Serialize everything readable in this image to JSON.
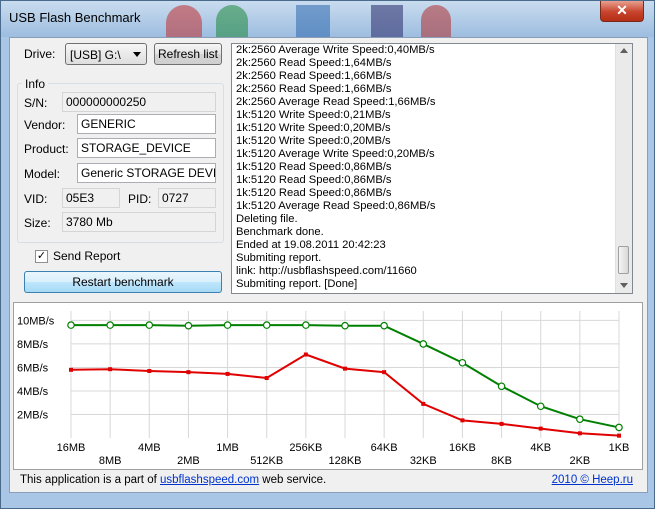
{
  "window": {
    "title": "USB Flash Benchmark",
    "close_glyph": "✕"
  },
  "drive": {
    "label": "Drive:",
    "value": "[USB] G:\\",
    "refresh_label": "Refresh list"
  },
  "info": {
    "group_label": "Info",
    "sn_label": "S/N:",
    "sn": "000000000250",
    "vendor_label": "Vendor:",
    "vendor": "GENERIC",
    "product_label": "Product:",
    "product": "STORAGE_DEVICE",
    "model_label": "Model:",
    "model": "Generic STORAGE DEVICE",
    "vid_label": "VID:",
    "vid": "05E3",
    "pid_label": "PID:",
    "pid": "0727",
    "size_label": "Size:",
    "size": "3780 Mb"
  },
  "send_report": {
    "label": "Send Report",
    "checked": true
  },
  "restart_label": "Restart benchmark",
  "log_lines": [
    "2k:2560 Average Write Speed:0,40MB/s",
    "2k:2560 Read Speed:1,64MB/s",
    "2k:2560 Read Speed:1,66MB/s",
    "2k:2560 Read Speed:1,66MB/s",
    "2k:2560 Average Read Speed:1,66MB/s",
    "1k:5120 Write Speed:0,21MB/s",
    "1k:5120 Write Speed:0,20MB/s",
    "1k:5120 Write Speed:0,20MB/s",
    "1k:5120 Average Write Speed:0,20MB/s",
    "1k:5120 Read Speed:0,86MB/s",
    "1k:5120 Read Speed:0,86MB/s",
    "1k:5120 Read Speed:0,86MB/s",
    "1k:5120 Average Read Speed:0,86MB/s",
    "Deleting file.",
    "Benchmark done.",
    "Ended at 19.08.2011 20:42:23",
    "Submiting report.",
    "link: http://usbflashspeed.com/11660",
    "Submiting report. [Done]"
  ],
  "footer": {
    "prefix": "This application is a part of ",
    "link": "usbflashspeed.com",
    "suffix": " web service.",
    "copyright": "2010 © Heep.ru"
  },
  "colors": {
    "read": "#008000",
    "write": "#e00000",
    "grid": "#d8d8d8"
  },
  "chart_data": {
    "type": "line",
    "categories": [
      "16MB",
      "8MB",
      "4MB",
      "2MB",
      "1MB",
      "512KB",
      "256KB",
      "128KB",
      "64KB",
      "32KB",
      "16KB",
      "8KB",
      "4KB",
      "2KB",
      "1KB"
    ],
    "yticks": [
      "2MB/s",
      "4MB/s",
      "6MB/s",
      "8MB/s",
      "10MB/s"
    ],
    "ylim": [
      0,
      10.8
    ],
    "series": [
      {
        "color": "#008000",
        "values": [
          9.6,
          9.6,
          9.6,
          9.55,
          9.6,
          9.6,
          9.6,
          9.55,
          9.55,
          8.0,
          6.4,
          4.4,
          2.7,
          1.6,
          0.9
        ]
      },
      {
        "color": "#e00000",
        "values": [
          5.8,
          5.85,
          5.7,
          5.6,
          5.45,
          5.1,
          7.1,
          5.9,
          5.6,
          2.9,
          1.5,
          1.2,
          0.8,
          0.4,
          0.2
        ]
      }
    ]
  }
}
